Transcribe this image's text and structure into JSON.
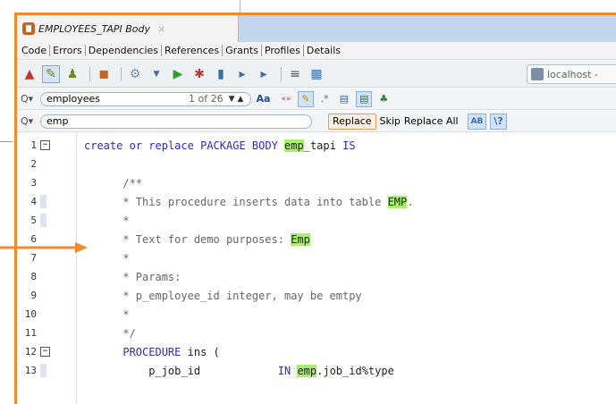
{
  "editor": {
    "title": "EMPLOYEES_TAPI Body",
    "close": "×",
    "subtabs": [
      "Code",
      "Errors",
      "Dependencies",
      "References",
      "Grants",
      "Profiles",
      "Details"
    ],
    "connection": "localhost -"
  },
  "find": {
    "value": "employees",
    "count": "1 of 26",
    "options": [
      "Aa",
      "«»"
    ]
  },
  "replace": {
    "value": "emp",
    "replace_label": "Replace",
    "skip_label": "Skip",
    "replace_all_label": "Replace All"
  },
  "code_lines": [
    {
      "n": "1",
      "pre": "create or replace PACKAGE BODY ",
      "hl": "emp",
      "post": "_tapi IS"
    },
    {
      "n": "2",
      "pre": "",
      "hl": "",
      "post": ""
    },
    {
      "n": "3",
      "pre": "      /**",
      "hl": "",
      "post": ""
    },
    {
      "n": "4",
      "pre": "      * This procedure inserts data into table ",
      "hl": "EMP",
      "post": "."
    },
    {
      "n": "5",
      "pre": "      *",
      "hl": "",
      "post": ""
    },
    {
      "n": "6",
      "pre": "      * Text for demo purposes: ",
      "hl": "Emp",
      "post": ""
    },
    {
      "n": "7",
      "pre": "      *",
      "hl": "",
      "post": ""
    },
    {
      "n": "8",
      "pre": "      * Params:",
      "hl": "",
      "post": ""
    },
    {
      "n": "9",
      "pre": "      * p_employee_id integer, may be emtpy",
      "hl": "",
      "post": ""
    },
    {
      "n": "10",
      "pre": "      *",
      "hl": "",
      "post": ""
    },
    {
      "n": "11",
      "pre": "      */",
      "hl": "",
      "post": ""
    },
    {
      "n": "12",
      "pre": "      PROCEDURE ins (",
      "hl": "",
      "post": ""
    },
    {
      "n": "13",
      "pre": "          p_job_id            IN ",
      "hl": "emp",
      "post": ".job_id%type"
    }
  ],
  "colors": {
    "accent": "#f28a2b",
    "match": "#a8f06a",
    "tabbar": "#c3d6ee"
  }
}
